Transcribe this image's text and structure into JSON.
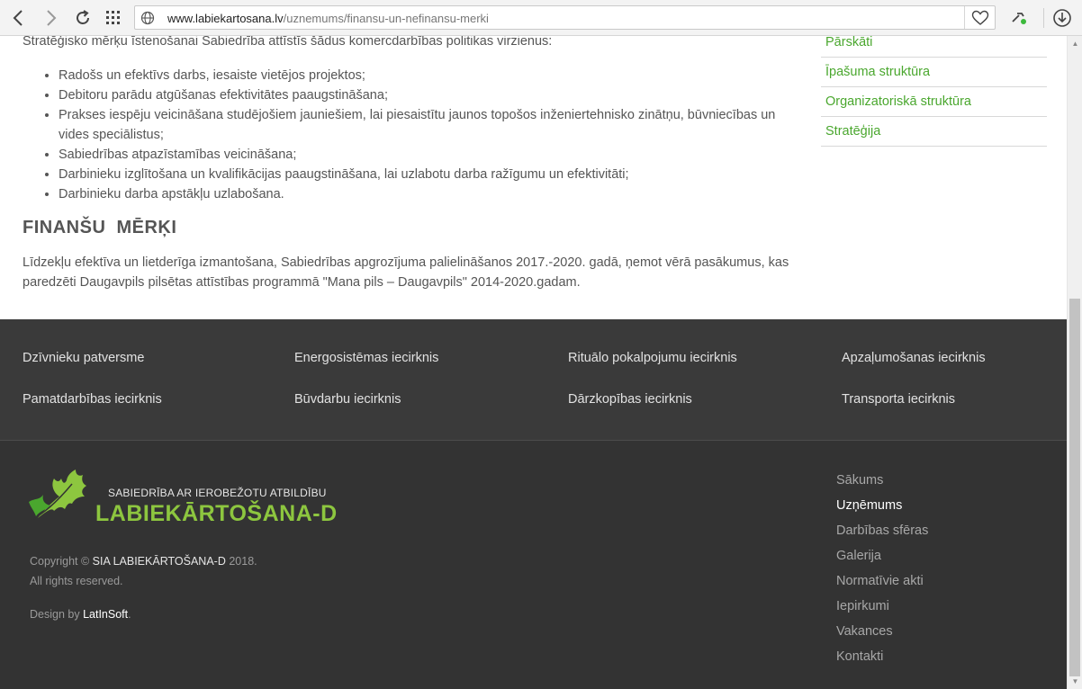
{
  "browser": {
    "url_host": "www.labiekartosana.lv",
    "url_path": "/uznemums/finansu-un-nefinansu-merki"
  },
  "content": {
    "intro": "Stratēģisko mērķu īstenošanai Sabiedrība attīstīs šādus komercdarbības  politikas virzienus:",
    "goals": [
      "Radošs un efektīvs darbs, iesaiste vietējos projektos;",
      "Debitoru parādu atgūšanas efektivitātes paaugstināšana;",
      "Prakses iespēju veicināšana studējošiem jauniešiem, lai piesaistītu jaunos topošos inženiertehnisko zinātņu, būvniecības un vides speciālistus;",
      "Sabiedrības atpazīstamības veicināšana;",
      "Darbinieku izglītošana un kvalifikācijas paaugstināšana, lai uzlabotu darba ražīgumu un efektivitāti;",
      "Darbinieku darba apstākļu uzlabošana."
    ],
    "fin_heading": "FINANŠU  MĒRĶI",
    "fin_text": "Līdzekļu efektīva un lietderīga izmantošana, Sabiedrības apgrozījuma palielināšanos 2017.-2020. gadā, ņemot vērā pasākumus, kas paredzēti Daugavpils pilsētas attīstības programmā \"Mana pils – Daugavpils\" 2014-2020.gadam."
  },
  "sidemenu": [
    "Pārskāti",
    "Īpašuma struktūra",
    "Organizatoriskā struktūra",
    "Stratēģija"
  ],
  "footer_links": [
    "Dzīvnieku patversme",
    "Energosistēmas iecirknis",
    "Rituālo pokalpojumu iecirknis",
    "Apzaļumošanas iecirknis",
    "Pamatdarbības iecirknis",
    "Būvdarbu iecirknis",
    "Dārzkopības iecirknis",
    "Transporta iecirknis"
  ],
  "footer": {
    "tagline": "SABIEDRĪBA AR IEROBEŽOTU ATBILDĪBU",
    "brand": "LABIEKĀRTOŠANA-D",
    "copyright_prefix": "Copyright © ",
    "copyright_owner": "SIA LABIEKĀRTOŠANA-D",
    "copyright_year": " 2018.",
    "rights": "All rights reserved.",
    "design_prefix": "Design by ",
    "design_by": "LatInSoft",
    "design_suffix": ".",
    "nav": [
      "Sākums",
      "Uzņēmums",
      "Darbības sfēras",
      "Galerija",
      "Normatīvie akti",
      "Iepirkumi",
      "Vakances",
      "Kontakti"
    ],
    "nav_active": "Uzņēmums"
  },
  "colors": {
    "accent_green": "#4aa72e",
    "brand_green": "#8dc63f",
    "footer_top": "#3a3a3a",
    "footer_bottom": "#333333"
  }
}
